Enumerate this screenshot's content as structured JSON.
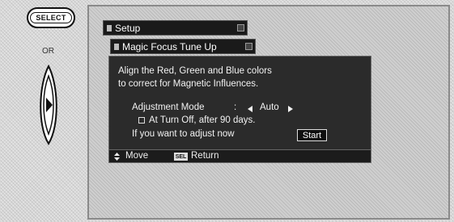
{
  "remote": {
    "select_label": "SELECT",
    "or_label": "OR",
    "rocker_icon": "right-arrow-icon"
  },
  "menu": {
    "title": "Setup",
    "submenu_title": "Magic Focus Tune Up"
  },
  "panel": {
    "description_line1": "Align the Red, Green and Blue colors",
    "description_line2": "to correct for Magnetic Influences.",
    "adjustment_label": "Adjustment Mode",
    "adjustment_colon": ":",
    "adjustment_value": "Auto",
    "checkbox_label": "At Turn Off, after 90 days.",
    "adjust_now_label": "If you want to adjust now",
    "start_button": "Start"
  },
  "footer": {
    "move_label": "Move",
    "sel_key": "SEL",
    "return_label": "Return"
  },
  "colors": {
    "bar_bg": "#1a1a1a",
    "panel_bg": "#2b2b2b",
    "text": "#f2f2f2"
  }
}
